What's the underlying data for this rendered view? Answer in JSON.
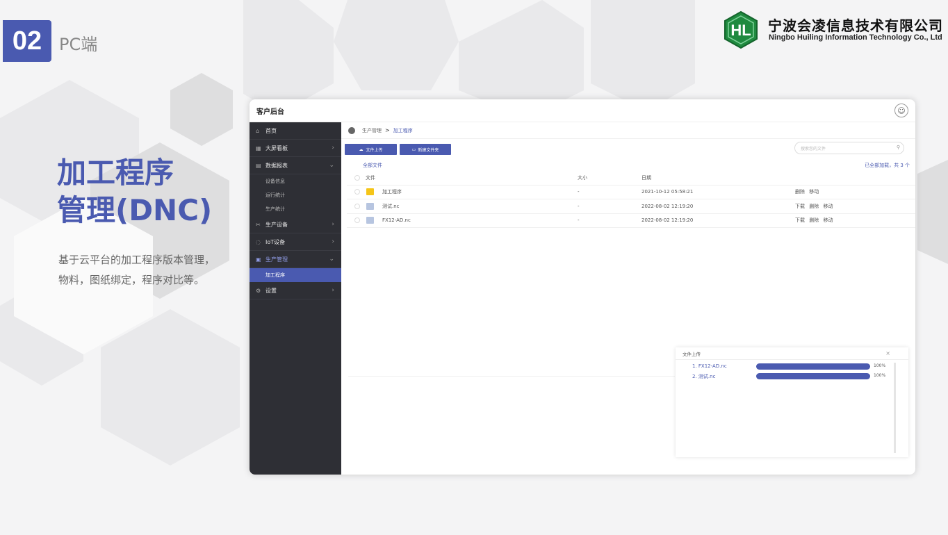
{
  "badge": {
    "number": "02",
    "label": "PC端"
  },
  "company": {
    "name_cn": "宁波会凌信息技术有限公司",
    "name_en": "Ningbo Huiling Information Technology Co., Ltd"
  },
  "heading": {
    "line1": "加工程序",
    "line2": "管理(DNC)"
  },
  "description": {
    "line1": "基于云平台的加工程序版本管理，",
    "line2": "物料，图纸绑定，程序对比等。"
  },
  "app": {
    "title": "客户后台",
    "sidebar": {
      "items": [
        {
          "label": "首页",
          "icon": "home-icon"
        },
        {
          "label": "大屏看板",
          "icon": "dashboard-icon"
        },
        {
          "label": "数据报表",
          "icon": "report-icon"
        },
        {
          "label": "设备信息"
        },
        {
          "label": "运行统计"
        },
        {
          "label": "生产统计"
        },
        {
          "label": "生产设备",
          "icon": "tools-icon"
        },
        {
          "label": "IoT设备",
          "icon": "iot-icon"
        },
        {
          "label": "生产管理",
          "icon": "manage-icon"
        },
        {
          "label": "加工程序"
        },
        {
          "label": "设置",
          "icon": "gear-icon"
        }
      ]
    },
    "breadcrumb": {
      "parent": "生产管理",
      "separator": ">",
      "current": "加工程序"
    },
    "toolbar": {
      "upload_label": "文件上传",
      "new_folder_label": "新建文件夹",
      "search_placeholder": "搜索您的文件"
    },
    "summary": {
      "all_files": "全部文件",
      "loaded": "已全部加载，共 3 个"
    },
    "table": {
      "headers": {
        "name": "文件",
        "size": "大小",
        "date": "日期"
      },
      "rows": [
        {
          "name": "加工程序",
          "size": "-",
          "date": "2021-10-12 05:58:21",
          "ops": [
            "删除",
            "移动"
          ],
          "type": "folder"
        },
        {
          "name": "测试.nc",
          "size": "-",
          "date": "2022-08-02 12:19:20",
          "ops": [
            "下载",
            "删除",
            "移动"
          ],
          "type": "file"
        },
        {
          "name": "FX12-AD.nc",
          "size": "-",
          "date": "2022-08-02 12:19:20",
          "ops": [
            "下载",
            "删除",
            "移动"
          ],
          "type": "file"
        }
      ]
    },
    "upload_panel": {
      "title": "文件上传",
      "close": "×",
      "items": [
        {
          "label": "1. FX12-AD.nc",
          "progress": "100%"
        },
        {
          "label": "2. 测试.nc",
          "progress": "100%"
        }
      ]
    }
  },
  "colors": {
    "accent": "#4a5ab0",
    "sidebar": "#2e2f35",
    "folder": "#f5c518",
    "logo": "#1f8a3f"
  }
}
